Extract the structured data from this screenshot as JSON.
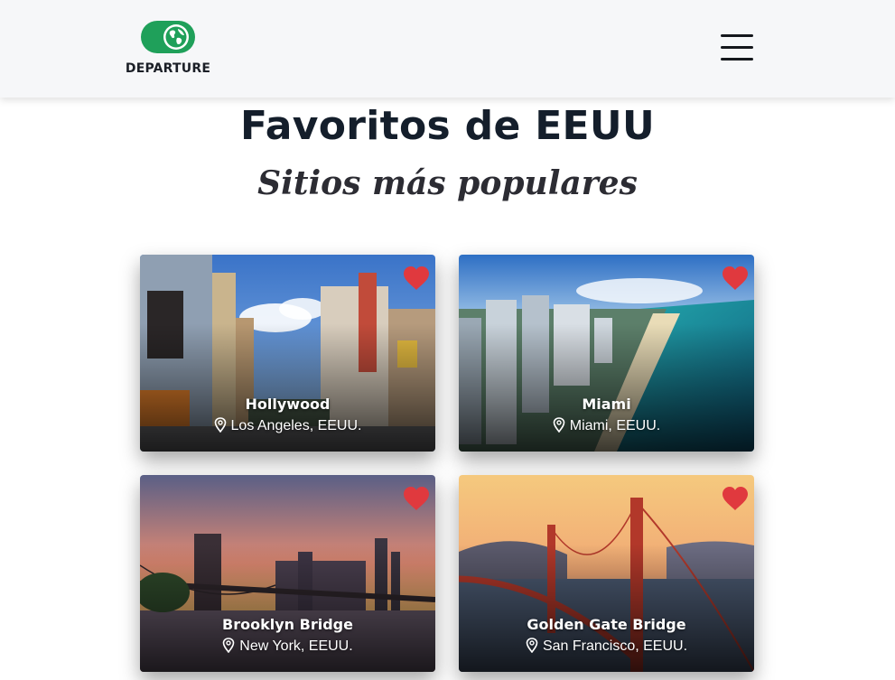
{
  "header": {
    "logo_text": "DEPARTURE",
    "logo_icon": "globe-icon",
    "menu_icon": "hamburger-menu-icon",
    "brand_color": "#1fa05a"
  },
  "main": {
    "title": "Favoritos de EEUU",
    "subtitle": "Sitios más populares"
  },
  "cards": [
    {
      "name": "Hollywood",
      "location": "Los Angeles, EEUU.",
      "favorite": true,
      "heart_color": "#e0393e",
      "icon": "location-pin-icon"
    },
    {
      "name": "Miami",
      "location": "Miami, EEUU.",
      "favorite": true,
      "heart_color": "#e0393e",
      "icon": "location-pin-icon"
    },
    {
      "name": "Brooklyn Bridge",
      "location": "New York, EEUU.",
      "favorite": true,
      "heart_color": "#e0393e",
      "icon": "location-pin-icon"
    },
    {
      "name": "Golden Gate Bridge",
      "location": "San Francisco, EEUU.",
      "favorite": true,
      "heart_color": "#e0393e",
      "icon": "location-pin-icon"
    }
  ]
}
